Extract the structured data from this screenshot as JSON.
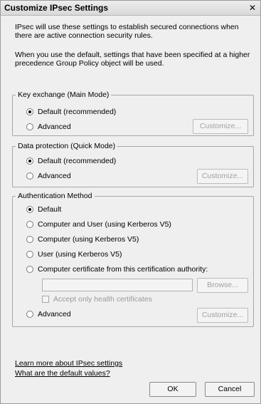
{
  "dialog": {
    "title": "Customize IPsec Settings",
    "close_glyph": "✕"
  },
  "intro": {
    "line1": "IPsec will use these settings to establish secured connections when there are active connection security rules.",
    "line2": "When you use the default, settings that have been specified at a higher precedence Group Policy object will be used."
  },
  "key_exchange": {
    "legend": "Key exchange (Main Mode)",
    "default_label": "Default (recommended)",
    "advanced_label": "Advanced",
    "customize_label": "Customize...",
    "selected": "default"
  },
  "data_protection": {
    "legend": "Data protection (Quick Mode)",
    "default_label": "Default (recommended)",
    "advanced_label": "Advanced",
    "customize_label": "Customize...",
    "selected": "default"
  },
  "authentication": {
    "legend": "Authentication Method",
    "options": [
      "Default",
      "Computer and User (using Kerberos V5)",
      "Computer (using Kerberos V5)",
      "User (using Kerberos V5)",
      "Computer certificate from this certification authority:",
      "Advanced"
    ],
    "selected": "Default",
    "ca_field_value": "",
    "browse_label": "Browse...",
    "health_cert_label": "Accept only health certificates",
    "customize_label": "Customize..."
  },
  "links": {
    "learn_more": "Learn more about IPsec settings",
    "defaults": "What are the default values?"
  },
  "footer": {
    "ok_label": "OK",
    "cancel_label": "Cancel"
  }
}
